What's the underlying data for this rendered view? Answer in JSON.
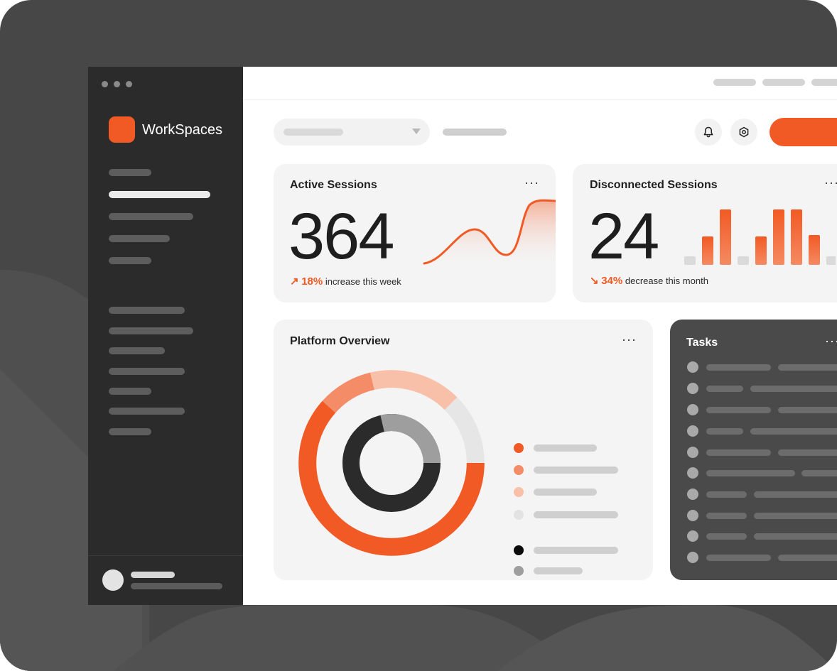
{
  "app": {
    "name": "WorkSpaces"
  },
  "colors": {
    "accent": "#f15a24",
    "sidebar": "#2b2b2b",
    "frame": "#474747",
    "card": "#f4f4f4",
    "tasks_card": "#4a4a4a"
  },
  "icons": {
    "notifications": "bell-icon",
    "settings": "gear-icon",
    "more": "more-icon"
  },
  "active_sessions": {
    "title": "Active Sessions",
    "value": "364",
    "trend_arrow": "↗",
    "trend_pct": "18%",
    "trend_text": "increase this week",
    "more": "···"
  },
  "disconnected_sessions": {
    "title": "Disconnected Sessions",
    "value": "24",
    "trend_arrow": "↘",
    "trend_pct": "34%",
    "trend_text": "decrease this month",
    "more": "···"
  },
  "platform_overview": {
    "title": "Platform Overview",
    "more": "···"
  },
  "tasks": {
    "title": "Tasks",
    "more": "···"
  }
}
